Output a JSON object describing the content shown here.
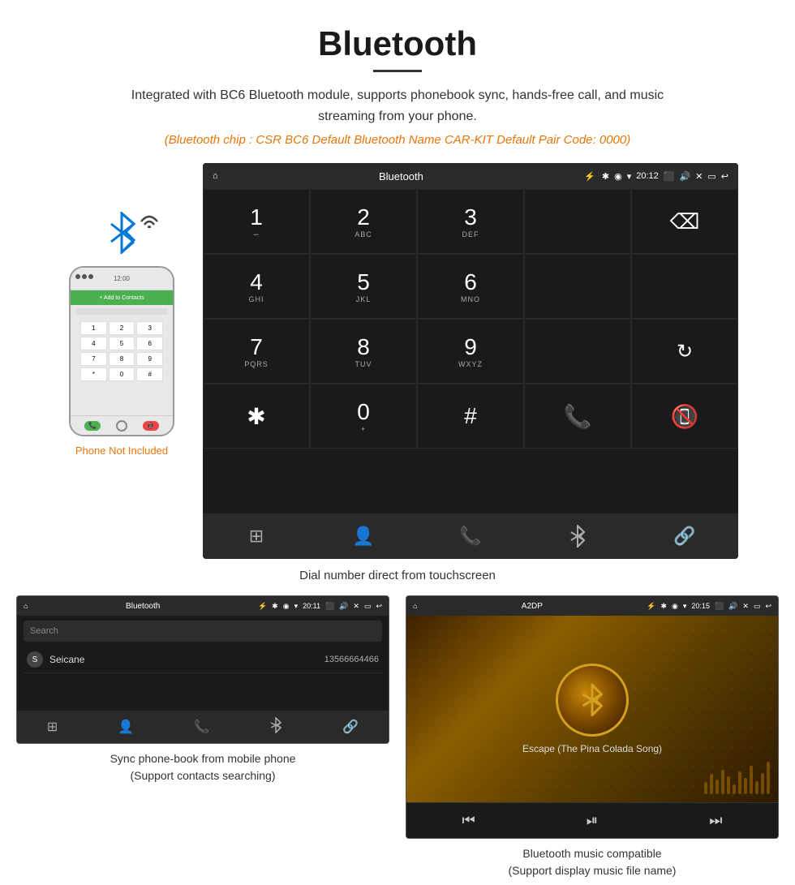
{
  "header": {
    "title": "Bluetooth",
    "description": "Integrated with BC6 Bluetooth module, supports phonebook sync, hands-free call, and music streaming from your phone.",
    "specs": "(Bluetooth chip : CSR BC6    Default Bluetooth Name CAR-KIT    Default Pair Code: 0000)"
  },
  "main_screen": {
    "status_bar": {
      "home_icon": "⌂",
      "title": "Bluetooth",
      "usb_icon": "⚡",
      "bt_icon": "✱",
      "location_icon": "◉",
      "signal_icon": "▼",
      "time": "20:12",
      "camera_icon": "📷",
      "volume_icon": "🔊",
      "close_icon": "✕",
      "window_icon": "▭",
      "back_icon": "↩"
    },
    "dialpad": [
      {
        "num": "1",
        "sub": "∽"
      },
      {
        "num": "2",
        "sub": "ABC"
      },
      {
        "num": "3",
        "sub": "DEF"
      },
      {
        "num": "",
        "sub": ""
      },
      {
        "num": "⌫",
        "sub": ""
      },
      {
        "num": "4",
        "sub": "GHI"
      },
      {
        "num": "5",
        "sub": "JKL"
      },
      {
        "num": "6",
        "sub": "MNO"
      },
      {
        "num": "",
        "sub": ""
      },
      {
        "num": "",
        "sub": ""
      },
      {
        "num": "7",
        "sub": "PQRS"
      },
      {
        "num": "8",
        "sub": "TUV"
      },
      {
        "num": "9",
        "sub": "WXYZ"
      },
      {
        "num": "",
        "sub": ""
      },
      {
        "num": "↻",
        "sub": ""
      },
      {
        "num": "✱",
        "sub": ""
      },
      {
        "num": "0",
        "sub": "+"
      },
      {
        "num": "#",
        "sub": ""
      },
      {
        "num": "📞",
        "sub": ""
      },
      {
        "num": "📵",
        "sub": ""
      }
    ],
    "nav_bar": {
      "icons": [
        "⊞",
        "👤",
        "📞",
        "✱",
        "🔗"
      ]
    }
  },
  "main_caption": "Dial number direct from touchscreen",
  "phone_label": "Phone Not Included",
  "bottom_left": {
    "status_bar": {
      "title": "Bluetooth",
      "time": "20:11"
    },
    "search_placeholder": "Search",
    "contact": {
      "letter": "S",
      "name": "Seicane",
      "number": "13566664466"
    },
    "caption_line1": "Sync phone-book from mobile phone",
    "caption_line2": "(Support contacts searching)"
  },
  "bottom_right": {
    "status_bar": {
      "title": "A2DP",
      "time": "20:15"
    },
    "song_title": "Escape (The Pina Colada Song)",
    "caption_line1": "Bluetooth music compatible",
    "caption_line2": "(Support display music file name)"
  }
}
